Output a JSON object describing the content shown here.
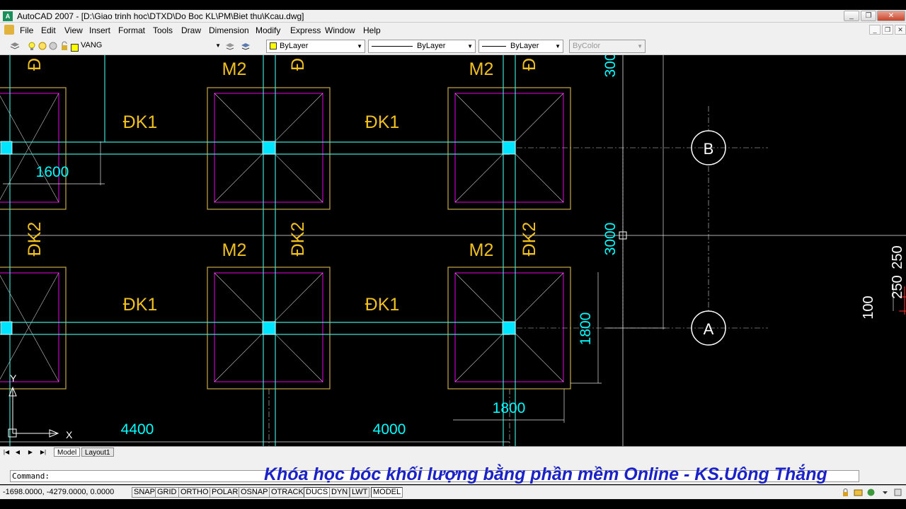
{
  "window": {
    "title": "AutoCAD 2007 - [D:\\Giao trinh hoc\\DTXD\\Do Boc KL\\PM\\Biet thu\\Kcau.dwg]",
    "minimize": "_",
    "maximize": "❐",
    "close": "✕"
  },
  "menu": {
    "items": [
      "File",
      "Edit",
      "View",
      "Insert",
      "Format",
      "Tools",
      "Draw",
      "Dimension",
      "Modify",
      "Express",
      "Window",
      "Help"
    ],
    "doc_controls": [
      "_",
      "❐",
      "✕"
    ]
  },
  "toolbar": {
    "layer": "VANG",
    "color": "ByLayer",
    "linetype": "ByLayer",
    "lineweight": "ByLayer",
    "plotstyle": "ByColor",
    "layer_color": "#ffff00"
  },
  "drawing": {
    "labels": {
      "m2": "M2",
      "dk1": "ĐK1",
      "dk2": "ĐK2",
      "d": "Đ"
    },
    "dims": {
      "d1600": "1600",
      "d4400": "4400",
      "d4000": "4000",
      "d1800": "1800",
      "d3000": "3000",
      "d300": "300",
      "d250a": "250",
      "d250b": "250",
      "d100": "100"
    },
    "grid_bubbles": {
      "b": "B",
      "a": "A"
    },
    "ucs": {
      "x": "X",
      "y": "Y"
    },
    "colors": {
      "footing": "#c8a848",
      "pedestal": "#c000c0",
      "beam": "#40e0d0",
      "text": "#f0c020",
      "dim": "#00ffff",
      "column": "#00e5ff"
    }
  },
  "tabs": {
    "nav": [
      "|◀",
      "◀",
      "▶",
      "▶|"
    ],
    "model": "Model",
    "layout": "Layout1"
  },
  "command": {
    "prompt": "Command:",
    "banner": "Khóa học bóc khối lượng bằng phần mềm Online - KS.Uông Thắng"
  },
  "status": {
    "coords": "-1698.0000, -4279.0000, 0.0000",
    "toggles": [
      "SNAP",
      "GRID",
      "ORTHO",
      "POLAR",
      "OSNAP",
      "OTRACK",
      "DUCS",
      "DYN",
      "LWT",
      "MODEL"
    ],
    "active": [
      "DUCS",
      "MODEL"
    ]
  }
}
